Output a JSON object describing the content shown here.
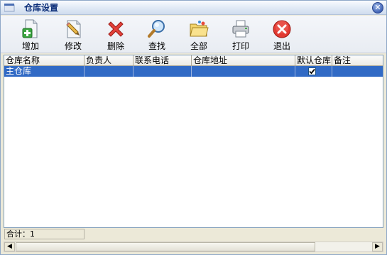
{
  "window": {
    "title": "仓库设置"
  },
  "toolbar": {
    "buttons": [
      {
        "label": "增加",
        "icon": "add-document-icon"
      },
      {
        "label": "修改",
        "icon": "edit-pen-icon"
      },
      {
        "label": "删除",
        "icon": "delete-x-icon"
      },
      {
        "label": "查找",
        "icon": "magnifier-icon"
      },
      {
        "label": "全部",
        "icon": "folder-icon"
      },
      {
        "label": "打印",
        "icon": "printer-icon"
      },
      {
        "label": "退出",
        "icon": "exit-icon"
      }
    ]
  },
  "grid": {
    "columns": [
      "仓库名称",
      "负责人",
      "联系电话",
      "仓库地址",
      "默认仓库",
      "备注"
    ],
    "rows": [
      {
        "name": "主仓库",
        "manager": "",
        "phone": "",
        "address": "",
        "default": true,
        "note": ""
      }
    ]
  },
  "footer": {
    "total": "合计：1"
  },
  "colors": {
    "selection": "#316ac5",
    "title_text": "#0b2d78"
  }
}
